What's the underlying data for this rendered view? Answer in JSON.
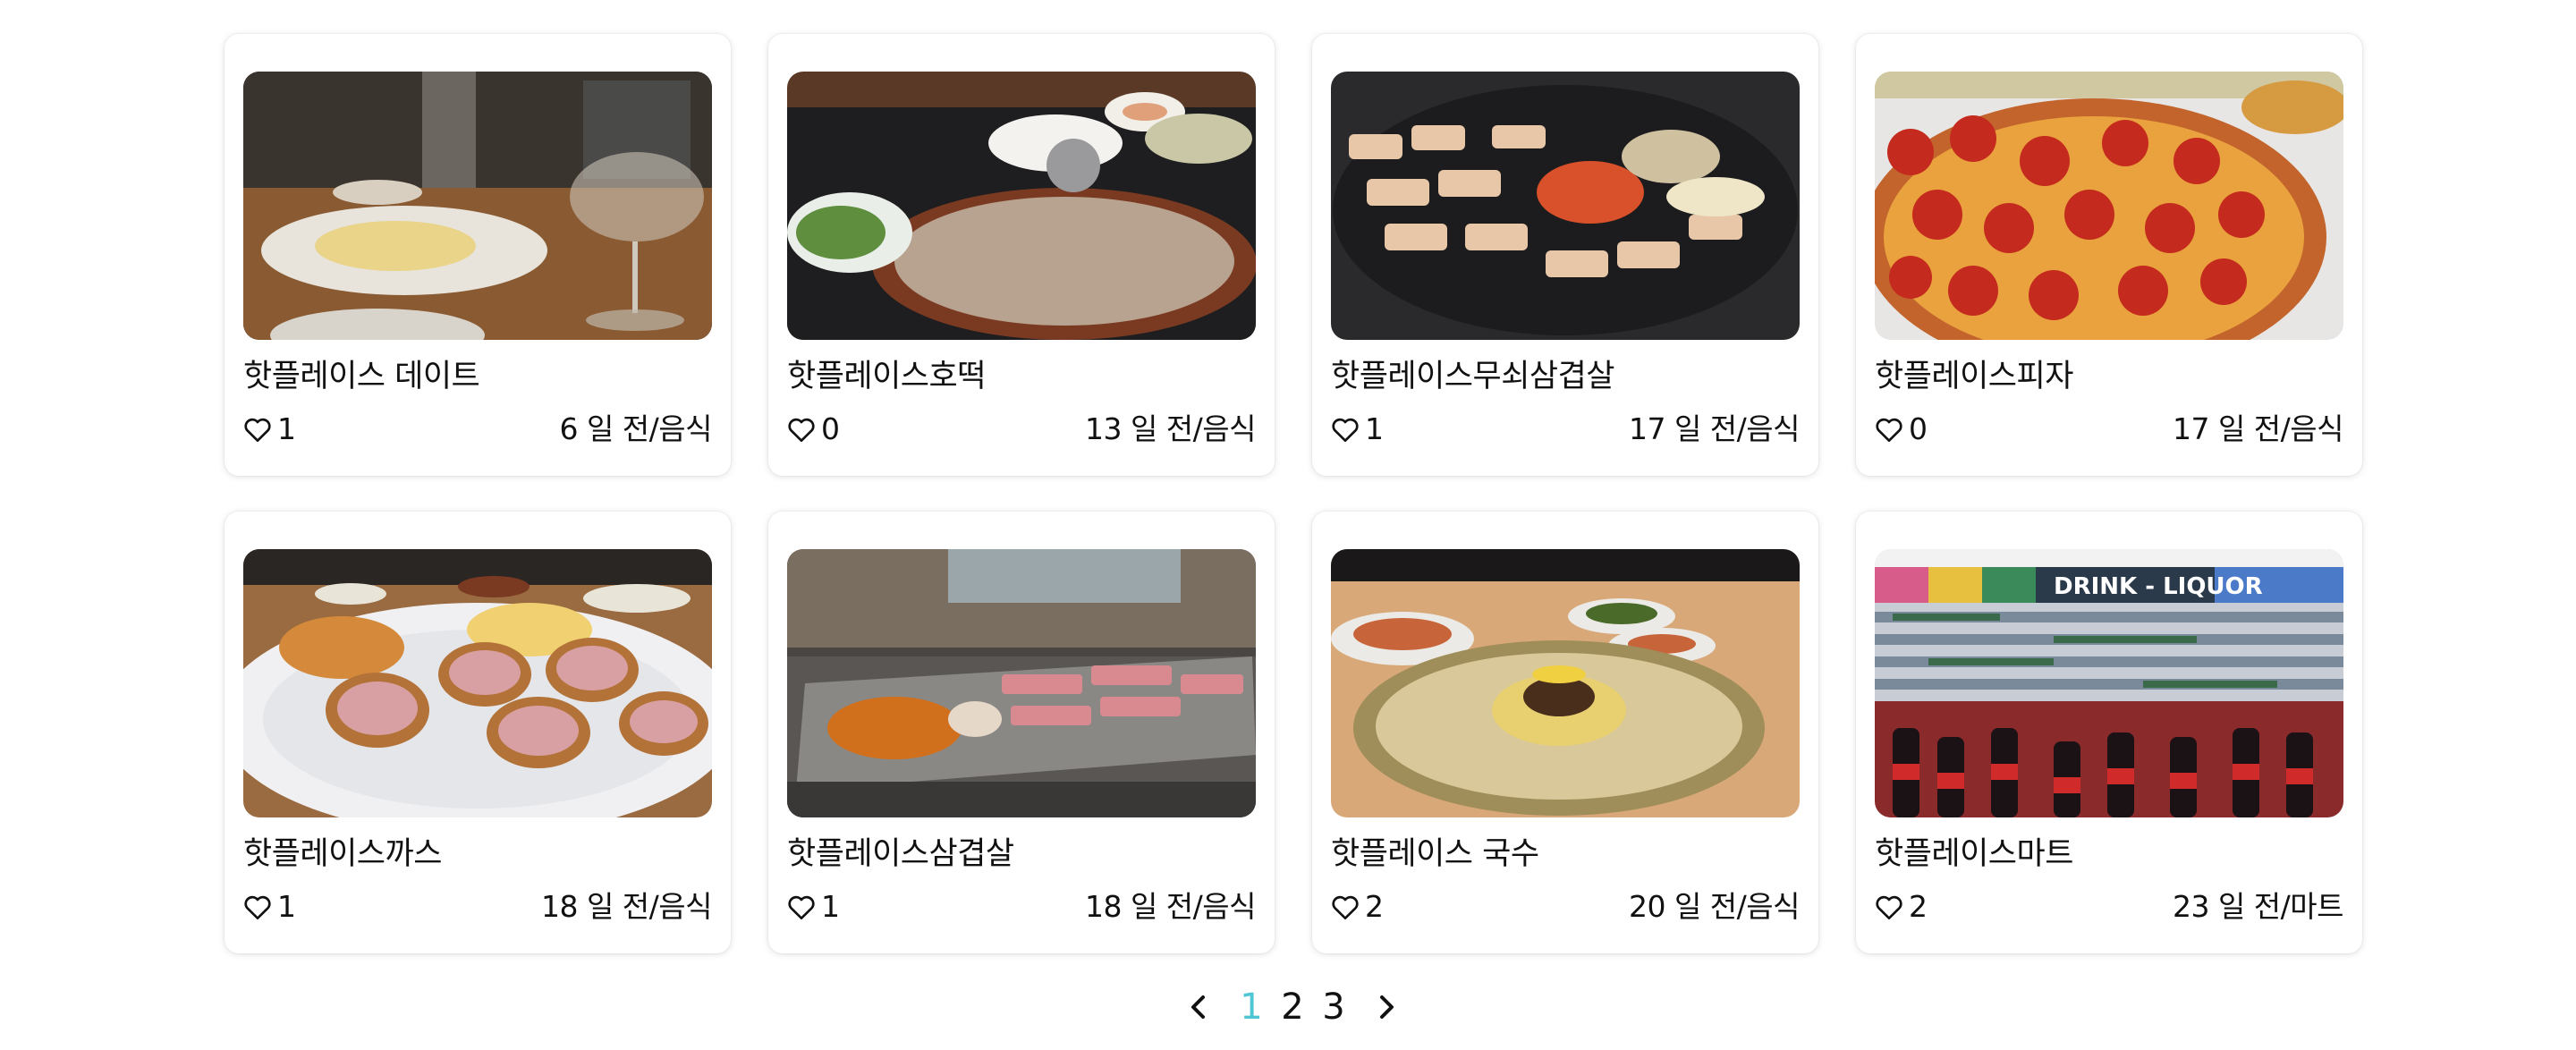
{
  "colors": {
    "active_page": "#4fc6d4",
    "text": "#111111",
    "card_bg": "#ffffff"
  },
  "cards": [
    {
      "title": "핫플레이스 데이트",
      "likes": "1",
      "date": "6 일 전/음식",
      "image": "wine-and-pasta-photo"
    },
    {
      "title": "핫플레이스호떡",
      "likes": "0",
      "date": "13 일 전/음식",
      "image": "hotteok-pizza-photo"
    },
    {
      "title": "핫플레이스무쇠삼겹살",
      "likes": "1",
      "date": "17 일 전/음식",
      "image": "grilled-pork-belly-photo"
    },
    {
      "title": "핫플레이스피자",
      "likes": "0",
      "date": "17 일 전/음식",
      "image": "pepperoni-pizza-photo"
    },
    {
      "title": "핫플레이스까스",
      "likes": "1",
      "date": "18 일 전/음식",
      "image": "pork-cutlet-photo"
    },
    {
      "title": "핫플레이스삼겹살",
      "likes": "1",
      "date": "18 일 전/음식",
      "image": "samgyeopsal-grill-photo"
    },
    {
      "title": "핫플레이스 국수",
      "likes": "2",
      "date": "20 일 전/음식",
      "image": "noodle-bowl-photo"
    },
    {
      "title": "핫플레이스마트",
      "likes": "2",
      "date": "23 일 전/마트",
      "image": "drink-liquor-store-photo",
      "sign_text": "DRINK - LIQUOR"
    }
  ],
  "pagination": {
    "prev_icon": "chevron-left-icon",
    "next_icon": "chevron-right-icon",
    "pages": [
      "1",
      "2",
      "3"
    ],
    "current": "1"
  }
}
